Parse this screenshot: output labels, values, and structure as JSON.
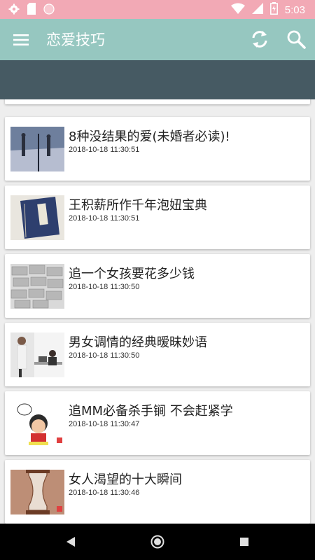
{
  "status_bar": {
    "time": "5:03",
    "left_icons": [
      "gear-icon",
      "sd-card-icon",
      "circle-icon"
    ],
    "right_icons": [
      "wifi-icon",
      "signal-icon",
      "battery-charging-icon"
    ]
  },
  "app_bar": {
    "title": "恋爱技巧",
    "icons": [
      "menu-icon",
      "refresh-icon",
      "search-icon"
    ]
  },
  "colors": {
    "status_bar": "#f2a9b5",
    "app_bar": "#96c7c0",
    "banner": "#465a63",
    "background": "#eeeeee"
  },
  "articles": [
    {
      "title": "8种没结果的爱(未婚者必读)!",
      "time": "2018-10-18 11:30:51"
    },
    {
      "title": "王积薪所作千年泡妞宝典",
      "time": "2018-10-18 11:30:51"
    },
    {
      "title": "追一个女孩要花多少钱",
      "time": "2018-10-18 11:30:50"
    },
    {
      "title": "男女调情的经典暧昧妙语",
      "time": "2018-10-18 11:30:50"
    },
    {
      "title": "追MM必备杀手锏 不会赶紧学",
      "time": "2018-10-18 11:30:47"
    },
    {
      "title": "女人渴望的十大瞬间",
      "time": "2018-10-18 11:30:46"
    }
  ],
  "nav_bar": {
    "icons": [
      "back-icon",
      "home-icon",
      "recents-icon"
    ]
  }
}
